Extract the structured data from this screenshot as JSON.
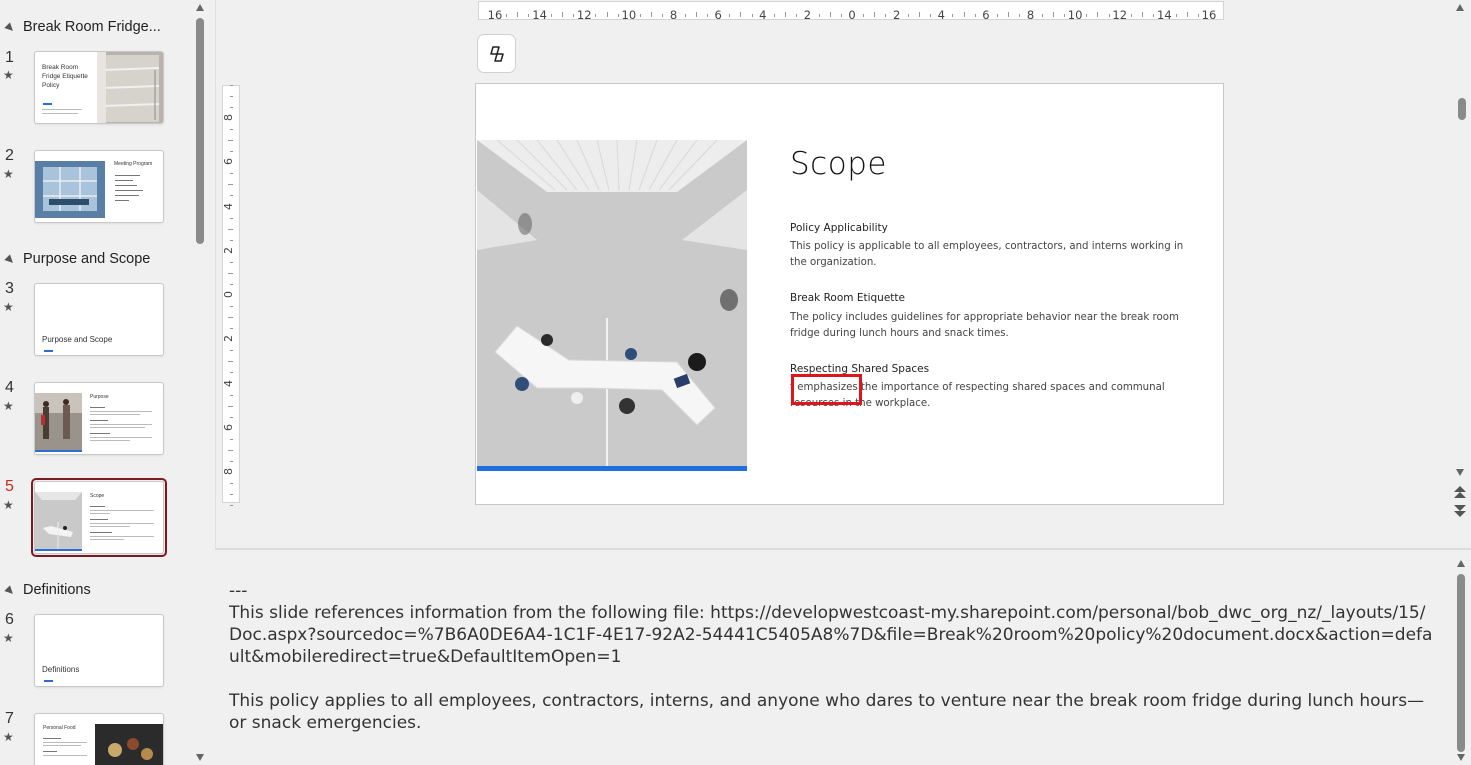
{
  "sections": [
    {
      "name": "Break Room Fridge..."
    },
    {
      "name": "Purpose and Scope"
    },
    {
      "name": "Definitions"
    }
  ],
  "slides": [
    {
      "number": "1",
      "title": "Break Room Fridge Etiquette Policy"
    },
    {
      "number": "2",
      "title": "Meeting Program"
    },
    {
      "number": "3",
      "title": "Purpose and Scope"
    },
    {
      "number": "4",
      "title": "Purpose"
    },
    {
      "number": "5",
      "title": "Scope",
      "selected": true
    },
    {
      "number": "6",
      "title": "Definitions"
    },
    {
      "number": "7",
      "title": "Personal Food"
    }
  ],
  "star_glyph": "★",
  "ruler": {
    "horizontal": [
      "16",
      "14",
      "12",
      "10",
      "8",
      "6",
      "4",
      "2",
      "0",
      "2",
      "4",
      "6",
      "8",
      "10",
      "12",
      "14",
      "16"
    ],
    "vertical": [
      "8",
      "6",
      "4",
      "2",
      "0",
      "2",
      "4",
      "6",
      "8"
    ]
  },
  "copilot_icon": "copilot-icon",
  "current_slide": {
    "title": "Scope",
    "blocks": [
      {
        "heading": "Policy Applicability",
        "body": "This policy is applicable to all employees, contractors, and interns working in the organization."
      },
      {
        "heading": "Break Room Etiquette",
        "body": "The policy includes guidelines for appropriate behavior near the break room fridge during lunch hours and snack times."
      },
      {
        "heading": "Respecting Shared Spaces",
        "body": "t emphasizes the importance of respecting shared spaces and communal resources in the workplace."
      }
    ],
    "accent_color": "#1f6fe0",
    "highlight_color": "#e0141b"
  },
  "notes": {
    "separator": "---",
    "reference": "This slide references information from the following file: https://developwestcoast-my.sharepoint.com/personal/bob_dwc_org_nz/_layouts/15/Doc.aspx?sourcedoc=%7B6A0DE6A4-1C1F-4E17-92A2-54441C5405A8%7D&file=Break%20room%20policy%20document.docx&action=default&mobileredirect=true&DefaultItemOpen=1",
    "body": "This policy applies to all employees, contractors, interns, and anyone who dares to venture near the break room fridge during lunch hours—or snack emergencies."
  }
}
